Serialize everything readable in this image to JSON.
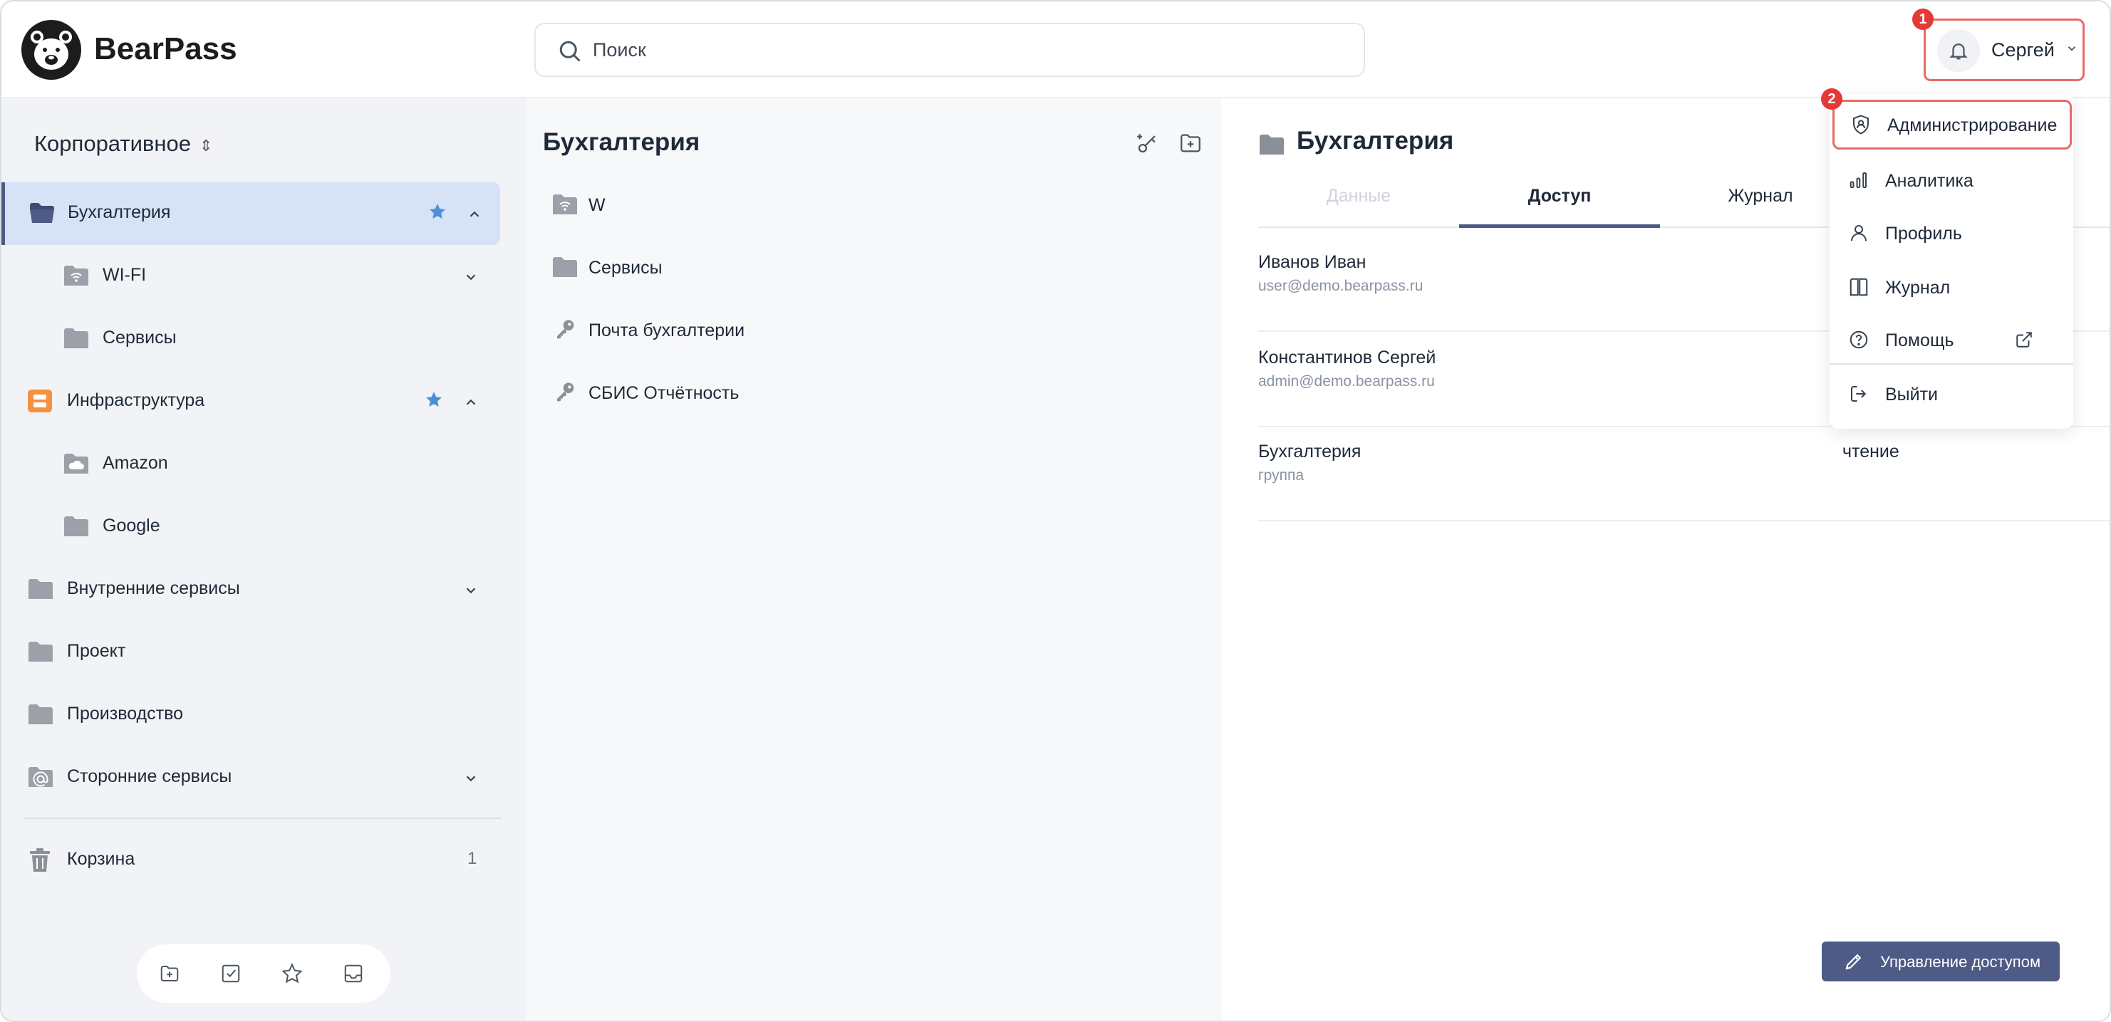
{
  "app": {
    "brand": "BearPass"
  },
  "search": {
    "placeholder": "Поиск"
  },
  "user": {
    "name": "Сергей"
  },
  "badges": {
    "first": "1",
    "second": "2"
  },
  "sidebar": {
    "vault": "Корпоративное",
    "items": [
      {
        "label": "Бухгалтерия",
        "icon": "folder-open-icon",
        "starred": true,
        "expanded": true,
        "active": true
      },
      {
        "label": "WI-FI",
        "icon": "wifi-folder-icon",
        "expandable": true
      },
      {
        "label": "Сервисы",
        "icon": "folder-icon"
      },
      {
        "label": "Инфраструктура",
        "icon": "server-folder-icon",
        "starred": true,
        "expanded": true
      },
      {
        "label": "Amazon",
        "icon": "cloud-folder-icon"
      },
      {
        "label": "Google",
        "icon": "folder-icon"
      },
      {
        "label": "Внутренние сервисы",
        "icon": "folder-icon",
        "expandable": true
      },
      {
        "label": "Проект",
        "icon": "folder-icon"
      },
      {
        "label": "Производство",
        "icon": "folder-icon"
      },
      {
        "label": "Сторонние сервисы",
        "icon": "at-folder-icon",
        "expandable": true
      }
    ],
    "trash": {
      "label": "Корзина",
      "count": "1"
    }
  },
  "middle": {
    "title": "Бухгалтерия",
    "rows": [
      {
        "label": "W",
        "icon": "wifi-folder-icon"
      },
      {
        "label": "Сервисы",
        "icon": "folder-icon"
      },
      {
        "label": "Почта бухгалтерии",
        "icon": "key-icon"
      },
      {
        "label": "СБИС Отчётность",
        "icon": "key-icon"
      }
    ]
  },
  "detail": {
    "title": "Бухгалтерия",
    "tabs": [
      {
        "label": "Данные",
        "state": "disabled"
      },
      {
        "label": "Доступ",
        "state": "active"
      },
      {
        "label": "Журнал",
        "state": "normal"
      }
    ],
    "access": [
      {
        "name": "Иванов Иван",
        "sub": "user@demo.bearpass.ru",
        "level": ""
      },
      {
        "name": "Константинов Сергей",
        "sub": "admin@demo.bearpass.ru",
        "level": ""
      },
      {
        "name": "Бухгалтерия",
        "sub": "группа",
        "level": "чтение"
      }
    ],
    "manage_button": "Управление доступом"
  },
  "menu": {
    "items": [
      {
        "label": "Администрирование",
        "icon": "admin-shield-icon"
      },
      {
        "label": "Аналитика",
        "icon": "analytics-icon"
      },
      {
        "label": "Профиль",
        "icon": "profile-icon"
      },
      {
        "label": "Журнал",
        "icon": "book-icon"
      },
      {
        "label": "Помощь",
        "icon": "help-icon"
      },
      {
        "label": "Выйти",
        "icon": "logout-icon"
      }
    ]
  },
  "colors": {
    "accent": "#4e5b86",
    "active_bg": "#d6e2f5",
    "highlight": "#e76a6a",
    "star": "#4a90d9",
    "infra_icon": "#f5913e"
  }
}
